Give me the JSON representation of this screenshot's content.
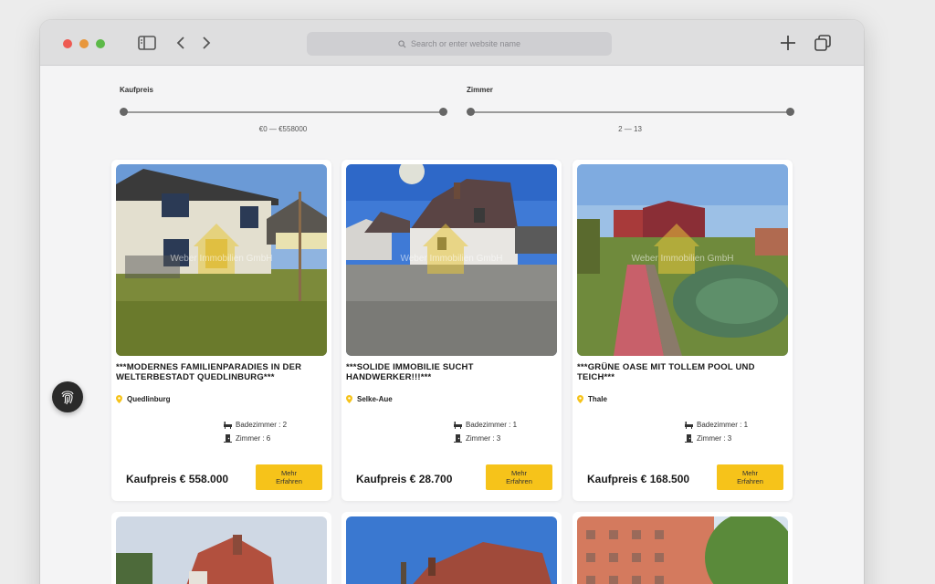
{
  "browser": {
    "address_placeholder": "Search or enter website name"
  },
  "filters": {
    "price": {
      "label": "Kaufpreis",
      "range": "€0 — €558000",
      "min": 0,
      "max": 558000
    },
    "rooms": {
      "label": "Zimmer",
      "range": "2 — 13",
      "min": 2,
      "max": 13
    }
  },
  "listings": [
    {
      "title": "***MODERNES FAMILIENPARADIES IN DER WELTERBESTADT QUEDLINBURG***",
      "location": "Quedlinburg",
      "bathrooms": "Badezimmer : 2",
      "rooms": "Zimmer : 6",
      "price": "Kaufpreis € 558.000",
      "button": "Mehr\nErfahren",
      "watermark": "Weber Immobilien GmbH"
    },
    {
      "title": "***SOLIDE IMMOBILIE SUCHT HANDWERKER!!!***",
      "location": "Selke-Aue",
      "bathrooms": "Badezimmer : 1",
      "rooms": "Zimmer : 3",
      "price": "Kaufpreis € 28.700",
      "button": "Mehr\nErfahren",
      "watermark": "Weber Immobilien GmbH"
    },
    {
      "title": "***GRÜNE OASE MIT TOLLEM POOL UND TEICH***",
      "location": "Thale",
      "bathrooms": "Badezimmer : 1",
      "rooms": "Zimmer : 3",
      "price": "Kaufpreis € 168.500",
      "button": "Mehr\nErfahren",
      "watermark": "Weber Immobilien GmbH"
    }
  ],
  "colors": {
    "accent": "#f6c31a",
    "pin": "#f6c31a"
  }
}
